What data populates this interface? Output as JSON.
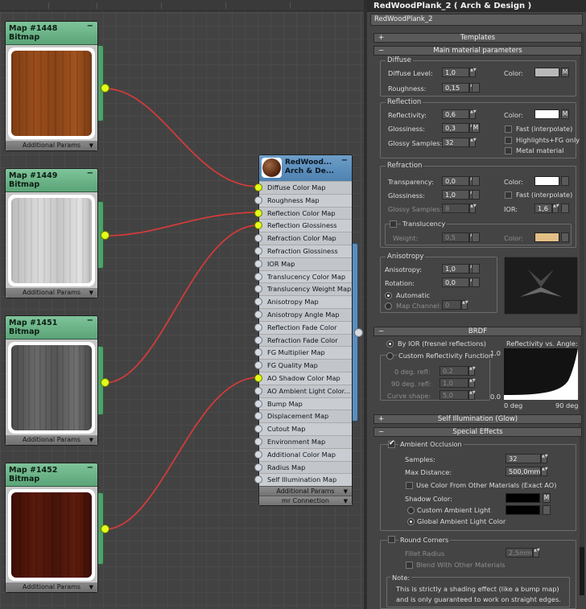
{
  "maps": [
    {
      "name": "Map #1448",
      "type": "Bitmap",
      "footer": "Additional Params"
    },
    {
      "name": "Map #1449",
      "type": "Bitmap",
      "footer": "Additional Params"
    },
    {
      "name": "Map #1451",
      "type": "Bitmap",
      "footer": "Additional Params"
    },
    {
      "name": "Map #1452",
      "type": "Bitmap",
      "footer": "Additional Params"
    }
  ],
  "material_node": {
    "title_line1": "RedWood...",
    "title_line2": "Arch & De...",
    "slots": [
      "Diffuse Color Map",
      "Roughness Map",
      "Reflection Color Map",
      "Reflection Glossiness Map",
      "Refraction Color Map",
      "Refraction Glossiness Map",
      "IOR Map",
      "Translucency Color Map",
      "Translucency Weight Map",
      "Anisotropy Map",
      "Anisotropy Angle Map",
      "Reflection Fade Color Map",
      "Refraction Fade Color Map",
      "FG Multiplier Map",
      "FG Quality Map",
      "AO Shadow Color Map",
      "AO Ambient Light Color...",
      "Bump Map",
      "Displacement Map",
      "Cutout Map",
      "Environment Map",
      "Additional Color Map",
      "Radius Map",
      "Self Illumination Map"
    ],
    "connected_slots": [
      0,
      2,
      3,
      15
    ],
    "footer1": "Additional Params",
    "footer2": "mr Connection"
  },
  "panel": {
    "title": "RedWoodPlank_2  ( Arch & Design )",
    "name_field": "RedWoodPlank_2",
    "rollouts": {
      "templates": "Templates",
      "main": "Main material parameters",
      "brdf": "BRDF",
      "self_illum": "Self Illumination (Glow)",
      "special": "Special Effects"
    },
    "diffuse": {
      "group": "Diffuse",
      "level_label": "Diffuse Level:",
      "level": "1,0",
      "roughness_label": "Roughness:",
      "roughness": "0,15",
      "color_label": "Color:",
      "m": "M",
      "color": "#b9b9b9"
    },
    "reflection": {
      "group": "Reflection",
      "reflectivity_label": "Reflectivity:",
      "reflectivity": "0,6",
      "glossiness_label": "Glossiness:",
      "glossiness": "0,3",
      "samples_label": "Glossy Samples:",
      "samples": "32",
      "color_label": "Color:",
      "m": "M",
      "color": "#ffffff",
      "fast": "Fast (interpolate)",
      "highlights": "Highlights+FG only",
      "metal": "Metal material"
    },
    "refraction": {
      "group": "Refraction",
      "transparency_label": "Transparency:",
      "transparency": "0,0",
      "glossiness_label": "Glossiness:",
      "glossiness": "1,0",
      "samples_label": "Glossy Samples:",
      "samples": "8",
      "color_label": "Color:",
      "color": "#ffffff",
      "fast": "Fast (interpolate)",
      "ior_label": "IOR:",
      "ior": "1,6",
      "translucency": "Translucency",
      "weight_label": "Weight:",
      "weight": "0,5",
      "trans_color_label": "Color:",
      "trans_color": "#e3bf86"
    },
    "anisotropy": {
      "group": "Anisotropy",
      "anisotropy_label": "Anisotropy:",
      "anisotropy": "1,0",
      "rotation_label": "Rotation:",
      "rotation": "0,0",
      "automatic": "Automatic",
      "channel_label": "Map Channel:",
      "channel": "0"
    },
    "brdf": {
      "by_ior": "By IOR (fresnel reflections)",
      "custom": "Custom Reflectivity Function",
      "deg0_label": "0 deg. refl:",
      "deg0": "0,2",
      "deg90_label": "90 deg. refl:",
      "deg90": "1,0",
      "curve_label": "Curve shape:",
      "curve": "5,0",
      "graph_title": "Reflectivity vs. Angle:",
      "y_top": "1.0",
      "y_bottom": "0.0",
      "x_left": "0 deg",
      "x_right": "90 deg"
    },
    "special": {
      "ao": "Ambient Occlusion",
      "samples_label": "Samples:",
      "samples": "32",
      "maxdist_label": "Max Distance:",
      "maxdist": "500,0mm",
      "use_color": "Use Color From Other Materials (Exact AO)",
      "shadow_label": "Shadow Color:",
      "m": "M",
      "custom_amb": "Custom Ambient Light",
      "global_amb": "Global Ambient Light Color",
      "round": "Round Corners",
      "fillet_label": "Fillet Radius",
      "fillet": "2,5mm",
      "blend": "Blend With Other Materials",
      "note_label": "Note:",
      "note1": "This is strictly a shading effect (like a bump map)",
      "note2": "and is only guaranteed to work on straight edges."
    }
  }
}
